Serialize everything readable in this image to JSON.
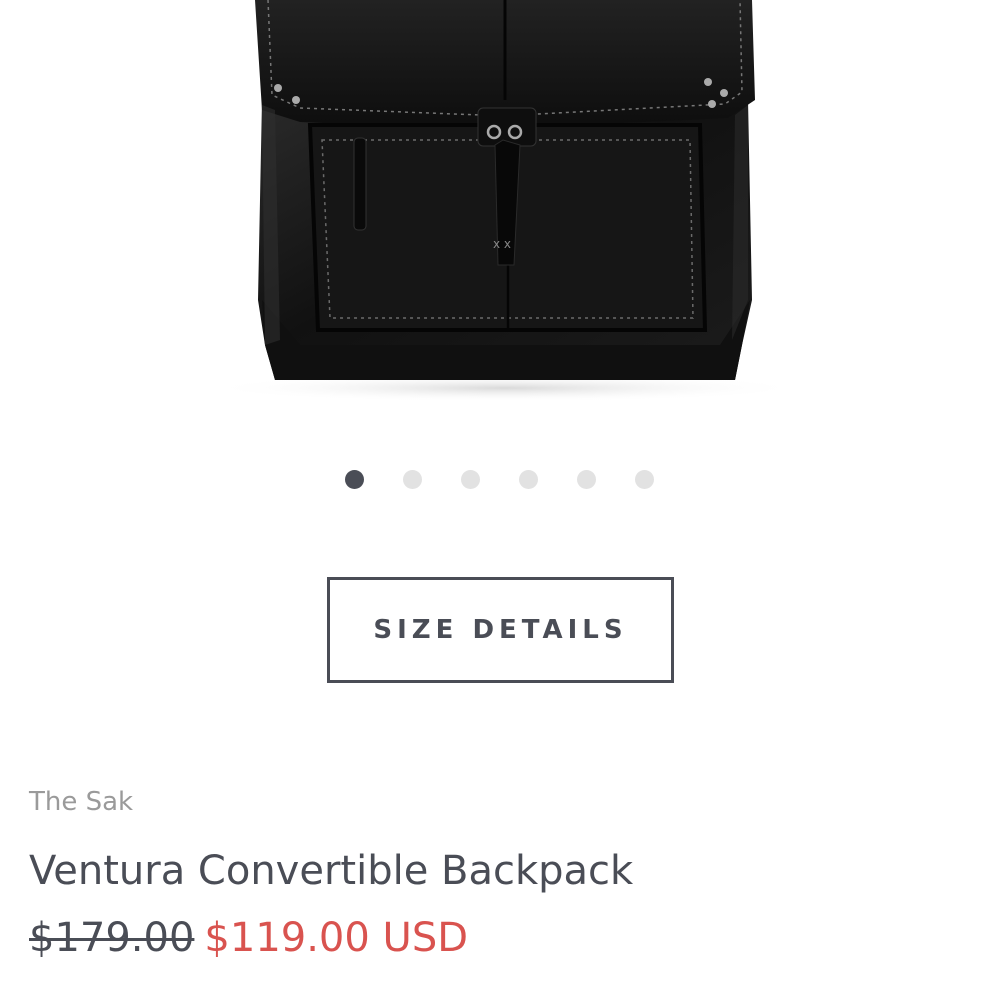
{
  "product_image": {
    "alt": "",
    "carousel": {
      "count": 6,
      "active_index": 0
    }
  },
  "size_details": {
    "label": "SIZE DETAILS"
  },
  "product": {
    "brand": "The Sak",
    "title": "Ventura Convertible Backpack",
    "price_original": "$179.00",
    "price_sale": "$119.00 USD"
  },
  "colors": {
    "primary_text": "#4a4d56",
    "secondary_text": "#9a9a9a",
    "sale": "#d9534f",
    "dot_inactive": "#e2e2e2",
    "dot_active": "#4a4d56"
  }
}
